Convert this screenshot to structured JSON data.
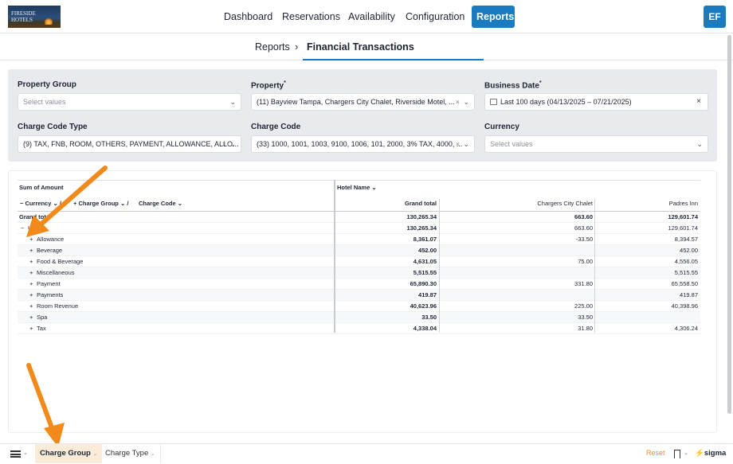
{
  "logo": {
    "line1": "FIRESIDE",
    "line2": "HOTELS"
  },
  "nav": {
    "items": [
      {
        "label": "Dashboard"
      },
      {
        "label": "Reservations"
      },
      {
        "label": "Availability"
      },
      {
        "label": "Configuration"
      },
      {
        "label": "Reports"
      }
    ],
    "active": "Reports",
    "avatar": "EF"
  },
  "breadcrumb": {
    "parent": "Reports",
    "separator": "›",
    "current": "Financial Transactions"
  },
  "filters": {
    "property_group": {
      "label": "Property Group",
      "placeholder": "Select values"
    },
    "property": {
      "label": "Property",
      "value": "(11) Bayview Tampa, Chargers City Chalet, Riverside Motel, ..."
    },
    "business_date": {
      "label": "Business Date",
      "value": "Last 100 days (04/13/2025 – 07/21/2025)"
    },
    "charge_code_type": {
      "label": "Charge Code Type",
      "value": "(9) TAX, FNB, ROOM, OTHERS, PAYMENT, ALLOWANCE, ALLO..."
    },
    "charge_code": {
      "label": "Charge Code",
      "value": "(33) 1000, 1001, 1003, 9100, 1006, 101, 2000, 3% TAX, 4000, ..."
    },
    "currency": {
      "label": "Currency",
      "placeholder": "Select values"
    }
  },
  "pivot": {
    "measure_label": "Sum of Amount",
    "column_dim": "Hotel Name",
    "row_dims": [
      "Currency",
      "Charge Group",
      "Charge Code"
    ],
    "columns": [
      "Grand total",
      "Chargers City Chalet",
      "Padres Inn"
    ],
    "grand_total_label": "Grand total",
    "rows": [
      {
        "label": "Grand total",
        "values": [
          "130,265.34",
          "663.60",
          "129,601.74"
        ]
      },
      {
        "label": "USD",
        "values": [
          "130,265.34",
          "663.60",
          "129,601.74"
        ]
      },
      {
        "label": "Allowance",
        "values": [
          "8,361.07",
          "-33.50",
          "8,394.57"
        ]
      },
      {
        "label": "Beverage",
        "values": [
          "452.00",
          "",
          "452.00"
        ]
      },
      {
        "label": "Food & Beverage",
        "values": [
          "4,631.05",
          "75.00",
          "4,556.05"
        ]
      },
      {
        "label": "Miscellaneous",
        "values": [
          "5,515.55",
          "",
          "5,515.55"
        ]
      },
      {
        "label": "Payment",
        "values": [
          "65,890.30",
          "331.80",
          "65,558.50"
        ]
      },
      {
        "label": "Payments",
        "values": [
          "419.87",
          "",
          "419.87"
        ]
      },
      {
        "label": "Room Revenue",
        "values": [
          "40,623.96",
          "225.00",
          "40,398.96"
        ]
      },
      {
        "label": "Spa",
        "values": [
          "33.50",
          "33.50",
          ""
        ]
      },
      {
        "label": "Tax",
        "values": [
          "4,338.04",
          "31.80",
          "4,306.24"
        ]
      }
    ]
  },
  "bottom": {
    "tabs": [
      {
        "label": "Charge Group"
      },
      {
        "label": "Charge Type"
      }
    ],
    "active_tab": "Charge Group",
    "reset": "Reset",
    "brand": "sigma"
  },
  "colors": {
    "accent": "#1a7bc0",
    "annotation_arrow": "#f28a1b",
    "active_tab_bg": "#fbecd9"
  }
}
